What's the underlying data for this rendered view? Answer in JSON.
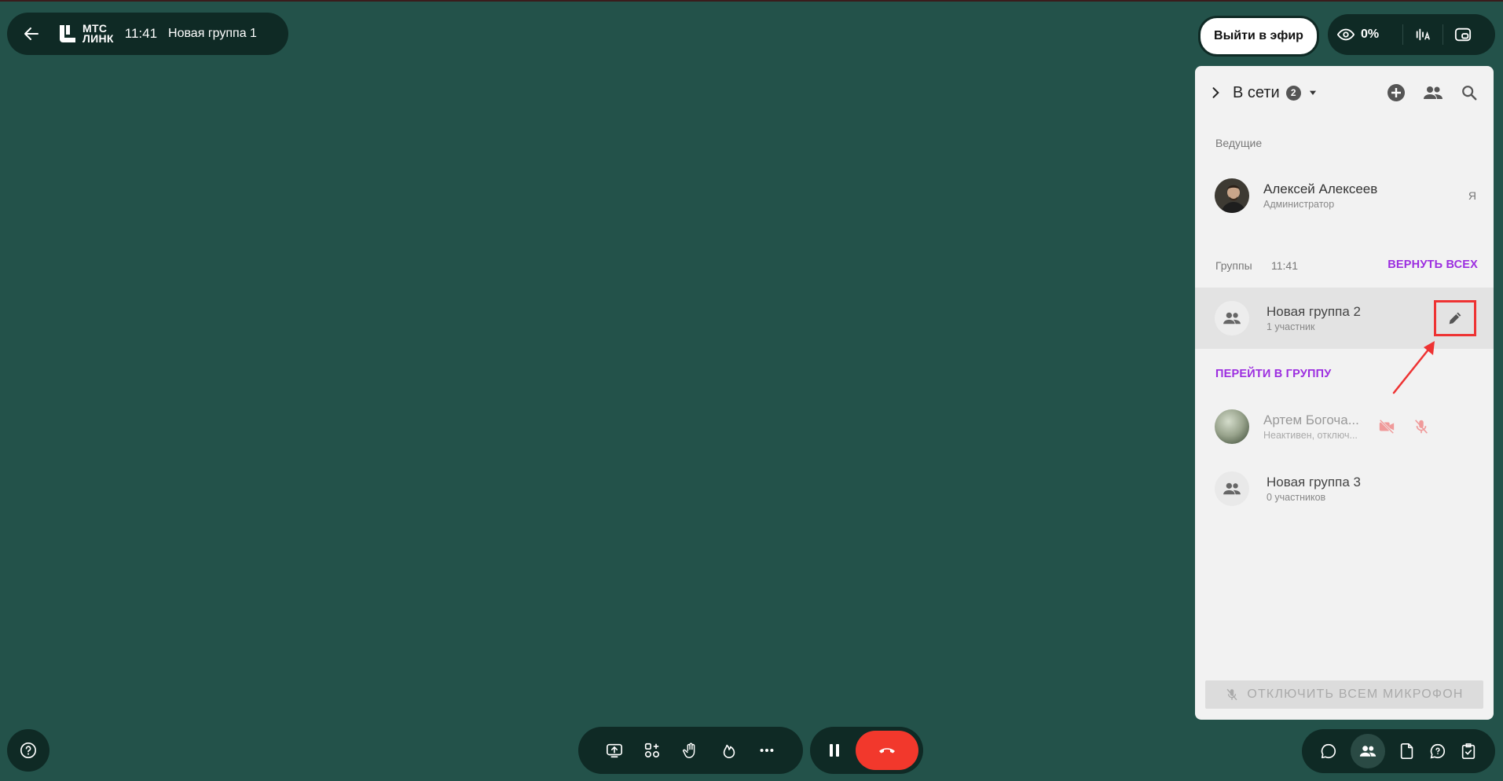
{
  "header": {
    "back_icon": "arrow-left-icon",
    "logo_line1": "МТС",
    "logo_line2": "ЛИНК",
    "time": "11:41",
    "group_name": "Новая группа 1"
  },
  "top_right": {
    "live_label": "Выйти в эфир",
    "percent": "0%",
    "icons": [
      "eye-icon",
      "audio-levels-icon",
      "picture-in-picture-icon"
    ]
  },
  "panel": {
    "title": "В сети",
    "count": "2",
    "hosts_label": "Ведущие",
    "host": {
      "name": "Алексей Алексеев",
      "role": "Администратор",
      "me": "Я"
    },
    "groups_label": "Группы",
    "groups_time": "11:41",
    "return_all": "ВЕРНУТЬ ВСЕХ",
    "groups": [
      {
        "name": "Новая группа 2",
        "sub": "1 участник"
      },
      {
        "name": "Новая группа 3",
        "sub": "0 участников"
      }
    ],
    "go_to_group": "ПЕРЕЙТИ В ГРУППУ",
    "member": {
      "name": "Артем Богоча...",
      "status": "Неактивен, отключ..."
    },
    "mute_all": "ОТКЛЮЧИТЬ ВСЕМ МИКРОФОН"
  },
  "colors": {
    "background": "#23524a",
    "pill": "#0f2a25",
    "accent_link": "#9c2de0",
    "end_call": "#f2382c",
    "highlight": "#ee3333"
  }
}
